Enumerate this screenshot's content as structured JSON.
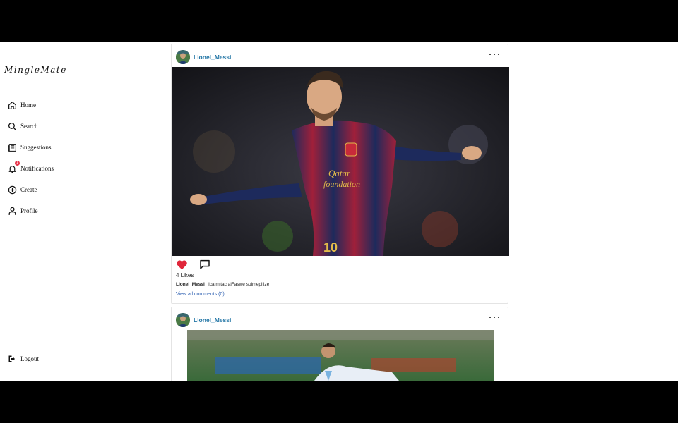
{
  "app": {
    "brand": "MingleMate"
  },
  "sidebar": {
    "items": [
      {
        "label": "Home",
        "icon": "home-icon"
      },
      {
        "label": "Search",
        "icon": "search-icon"
      },
      {
        "label": "Suggestions",
        "icon": "newspaper-icon"
      },
      {
        "label": "Notifications",
        "icon": "bell-icon",
        "badge": "1"
      },
      {
        "label": "Create",
        "icon": "plus-circle-icon"
      },
      {
        "label": "Profile",
        "icon": "user-icon"
      }
    ],
    "logout": {
      "label": "Logout",
      "icon": "logout-icon"
    }
  },
  "feed": {
    "posts": [
      {
        "username": "Lionel_Messi",
        "liked": true,
        "likes_text": "4 Likes",
        "caption_user": "Lionel_Messi",
        "caption_text": "lica mitac aiFaswe suirnepilize",
        "comments_link": "View all comments (0)"
      },
      {
        "username": "Lionel_Messi"
      }
    ]
  },
  "colors": {
    "accent_link": "#2376a6",
    "like_red": "#e0263a",
    "badge": "#e8334a",
    "comments_link": "#2a5db0"
  }
}
